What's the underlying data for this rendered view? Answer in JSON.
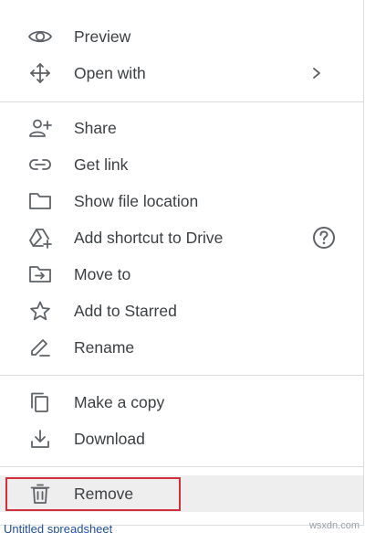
{
  "menu": {
    "items": [
      {
        "label": "Preview",
        "icon": "eye-icon"
      },
      {
        "label": "Open with",
        "icon": "move-arrows-icon"
      },
      {
        "label": "Share",
        "icon": "person-add-icon"
      },
      {
        "label": "Get link",
        "icon": "link-icon"
      },
      {
        "label": "Show file location",
        "icon": "folder-icon"
      },
      {
        "label": "Add shortcut to Drive",
        "icon": "drive-add-icon"
      },
      {
        "label": "Move to",
        "icon": "folder-move-icon"
      },
      {
        "label": "Add to Starred",
        "icon": "star-icon"
      },
      {
        "label": "Rename",
        "icon": "pencil-icon"
      },
      {
        "label": "Make a copy",
        "icon": "copy-icon"
      },
      {
        "label": "Download",
        "icon": "download-icon"
      },
      {
        "label": "Remove",
        "icon": "trash-icon"
      }
    ]
  },
  "colors": {
    "text": "#3c4043",
    "icon": "#5f6368",
    "divider": "#dadce0",
    "highlight_border": "#d32f3f",
    "selected_bg": "#eeeeee"
  },
  "background_text": "Untitled spreadsheet",
  "watermark": "wsxdn.com"
}
